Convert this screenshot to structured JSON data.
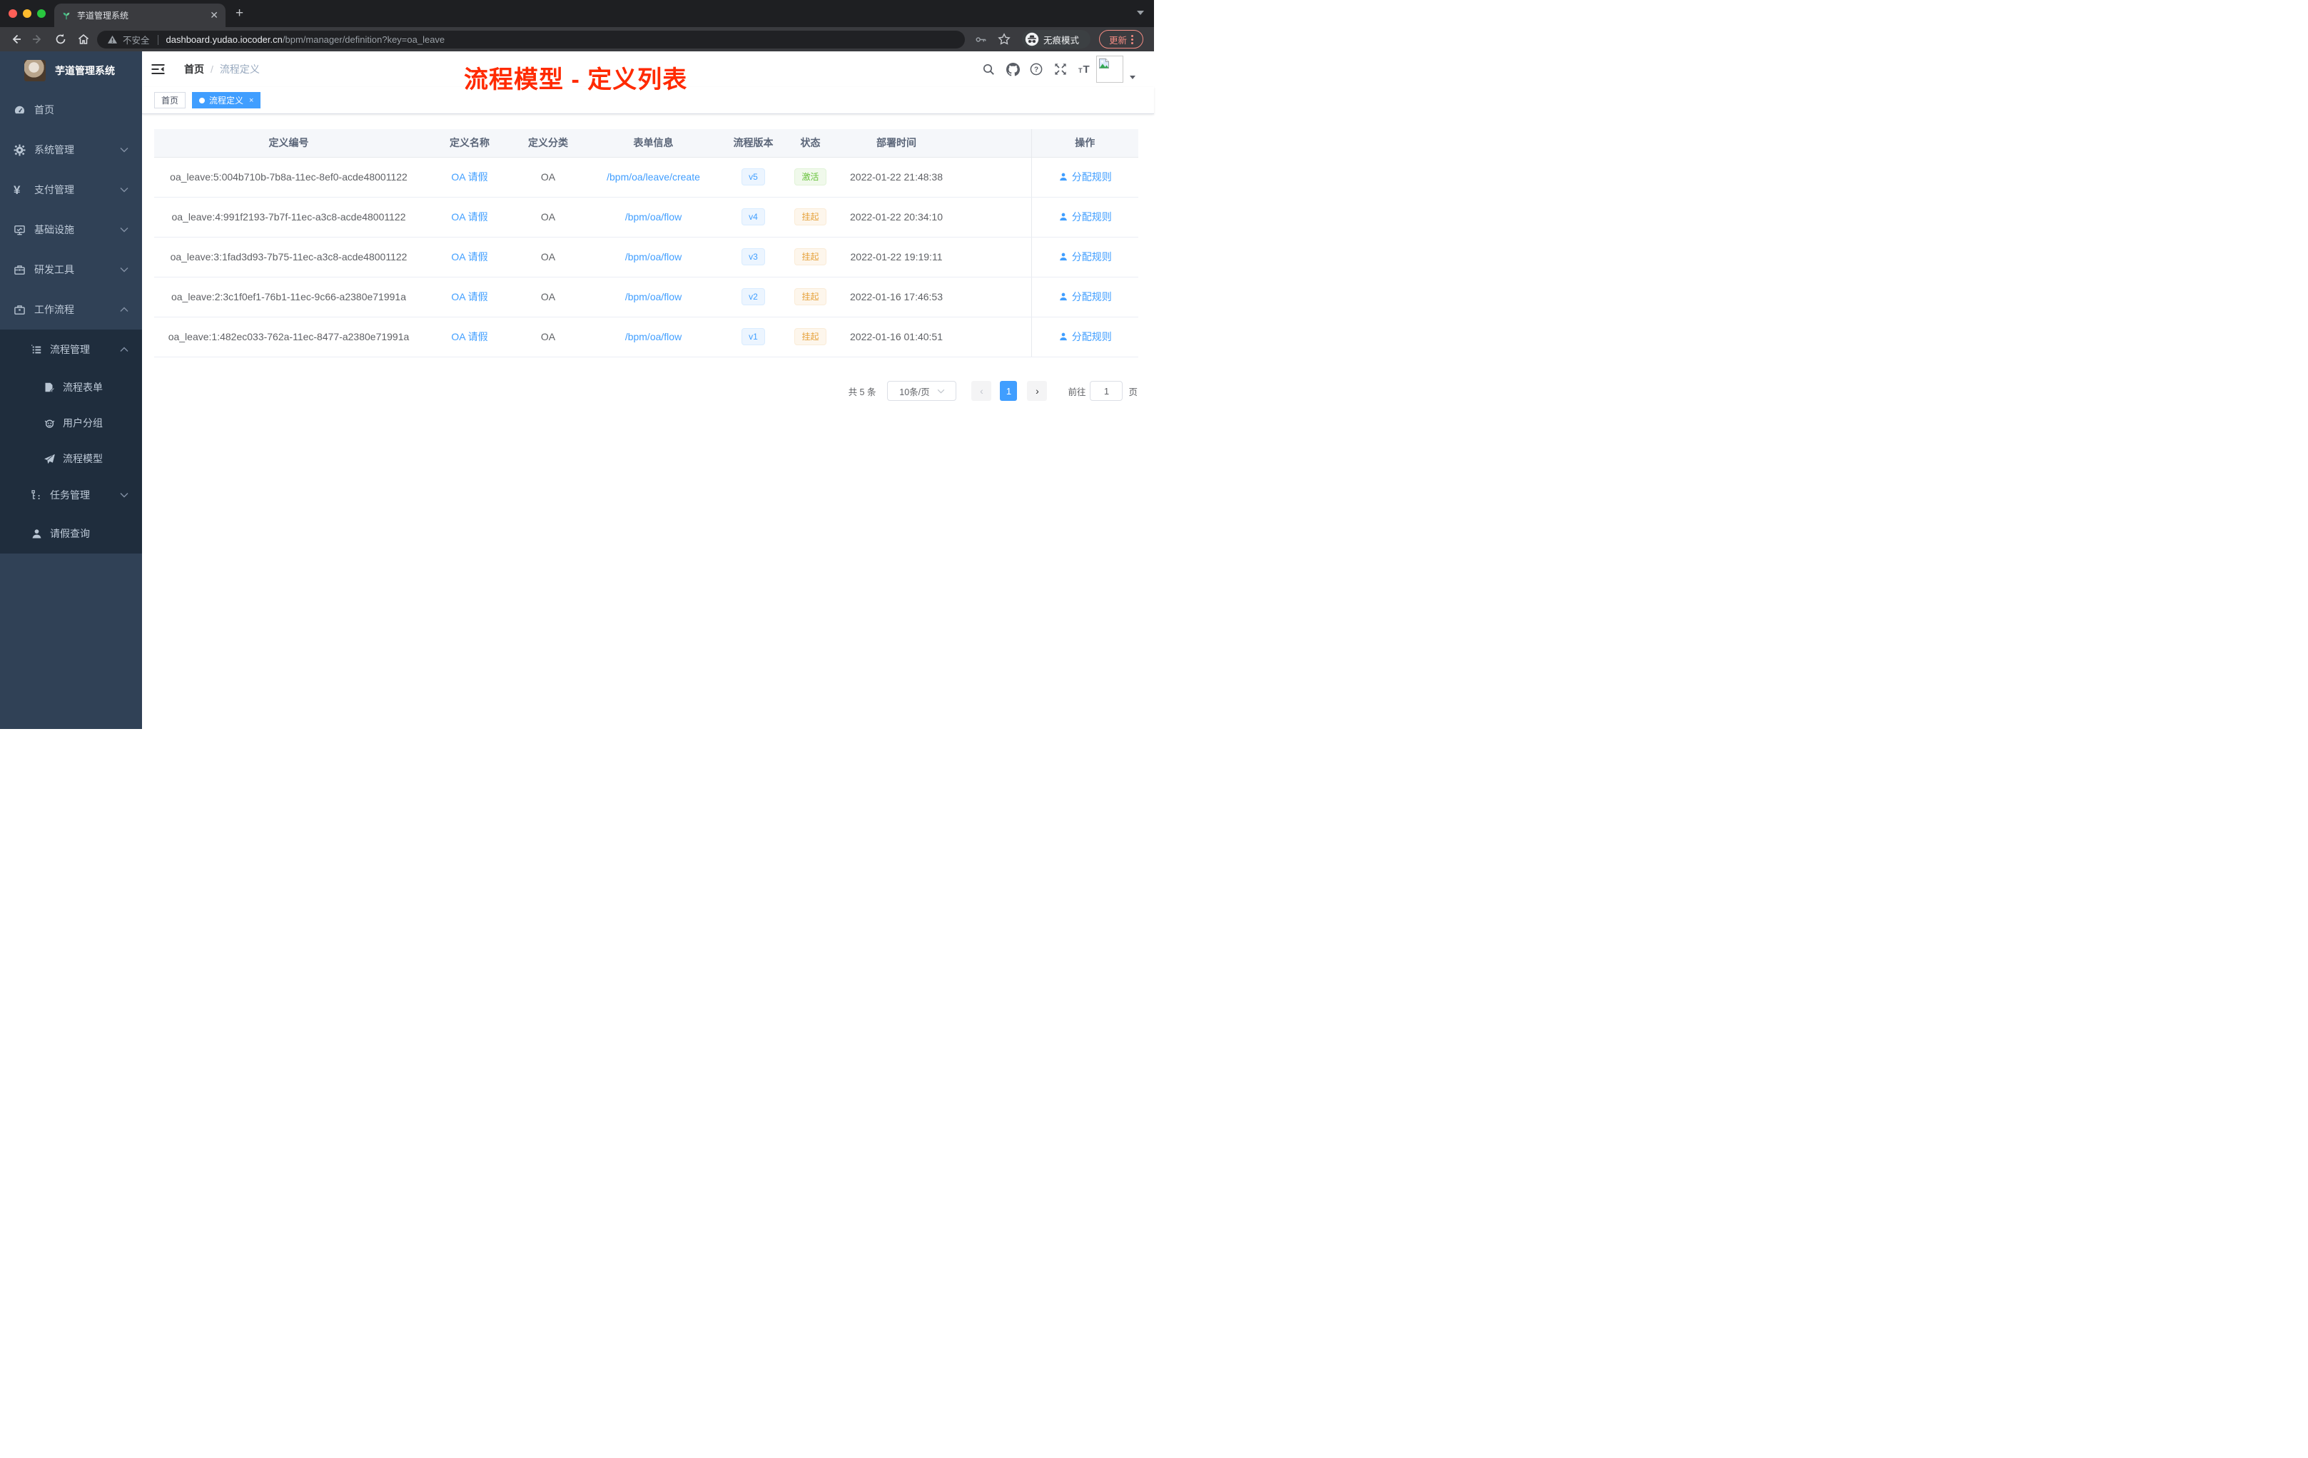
{
  "browser": {
    "tab_title": "芋道管理系统",
    "new_tab_button": "+",
    "security_label": "不安全",
    "url_host": "dashboard.yudao.iocoder.cn",
    "url_path": "/bpm/manager/definition?key=oa_leave",
    "incognito_label": "无痕模式",
    "update_button": "更新"
  },
  "sidebar": {
    "logo_title": "芋道管理系统",
    "items": [
      {
        "label": "首页",
        "icon": "dashboard-icon"
      },
      {
        "label": "系统管理",
        "icon": "gear-icon",
        "expand": "down"
      },
      {
        "label": "支付管理",
        "icon": "yen-icon",
        "expand": "down",
        "icon_glyph": "¥"
      },
      {
        "label": "基础设施",
        "icon": "monitor-icon",
        "expand": "down"
      },
      {
        "label": "研发工具",
        "icon": "toolbox-icon",
        "expand": "down"
      },
      {
        "label": "工作流程",
        "icon": "briefcase-icon",
        "expand": "up"
      },
      {
        "label": "流程管理",
        "icon": "tree-table-icon",
        "expand": "up"
      },
      {
        "label": "流程表单",
        "icon": "form-icon"
      },
      {
        "label": "用户分组",
        "icon": "user-group-icon"
      },
      {
        "label": "流程模型",
        "icon": "paper-plane-icon"
      },
      {
        "label": "任务管理",
        "icon": "org-tree-icon",
        "expand": "down"
      },
      {
        "label": "请假查询",
        "icon": "person-icon"
      }
    ]
  },
  "header": {
    "breadcrumb_home": "首页",
    "breadcrumb_sep": "/",
    "breadcrumb_current": "流程定义",
    "annotation": "流程模型 - 定义列表",
    "icons": [
      "search-icon",
      "github-icon",
      "help-icon",
      "fullscreen-icon",
      "text-size-icon",
      "avatar",
      "caret-down-icon"
    ]
  },
  "tags": {
    "home": "首页",
    "active": "流程定义",
    "active_close": "×"
  },
  "table": {
    "columns": [
      "定义编号",
      "定义名称",
      "定义分类",
      "表单信息",
      "流程版本",
      "状态",
      "部署时间",
      "操作"
    ],
    "action_label": "分配规则",
    "rows": [
      {
        "id": "oa_leave:5:004b710b-7b8a-11ec-8ef0-acde48001122",
        "name": "OA 请假",
        "category": "OA",
        "form": "/bpm/oa/leave/create",
        "version": "v5",
        "status": "激活",
        "deployed": "2022-01-22 21:48:38"
      },
      {
        "id": "oa_leave:4:991f2193-7b7f-11ec-a3c8-acde48001122",
        "name": "OA 请假",
        "category": "OA",
        "form": "/bpm/oa/flow",
        "version": "v4",
        "status": "挂起",
        "deployed": "2022-01-22 20:34:10"
      },
      {
        "id": "oa_leave:3:1fad3d93-7b75-11ec-a3c8-acde48001122",
        "name": "OA 请假",
        "category": "OA",
        "form": "/bpm/oa/flow",
        "version": "v3",
        "status": "挂起",
        "deployed": "2022-01-22 19:19:11"
      },
      {
        "id": "oa_leave:2:3c1f0ef1-76b1-11ec-9c66-a2380e71991a",
        "name": "OA 请假",
        "category": "OA",
        "form": "/bpm/oa/flow",
        "version": "v2",
        "status": "挂起",
        "deployed": "2022-01-16 17:46:53"
      },
      {
        "id": "oa_leave:1:482ec033-762a-11ec-8477-a2380e71991a",
        "name": "OA 请假",
        "category": "OA",
        "form": "/bpm/oa/flow",
        "version": "v1",
        "status": "挂起",
        "deployed": "2022-01-16 01:40:51"
      }
    ]
  },
  "pagination": {
    "total": "共 5 条",
    "page_size": "10条/页",
    "current_page": "1",
    "prev": "‹",
    "next": "›",
    "goto_label": "前往",
    "goto_value": "1",
    "page_unit": "页"
  },
  "colors": {
    "accent_blue": "#409eff",
    "status_active_green": "#67c23a",
    "status_suspended_orange": "#e6a23c",
    "annotation_red": "#ff2a00",
    "sidebar_bg": "#304156",
    "sidebar_submenu_bg": "#1f2d3d",
    "chrome_update_salmon": "#f28b82"
  }
}
